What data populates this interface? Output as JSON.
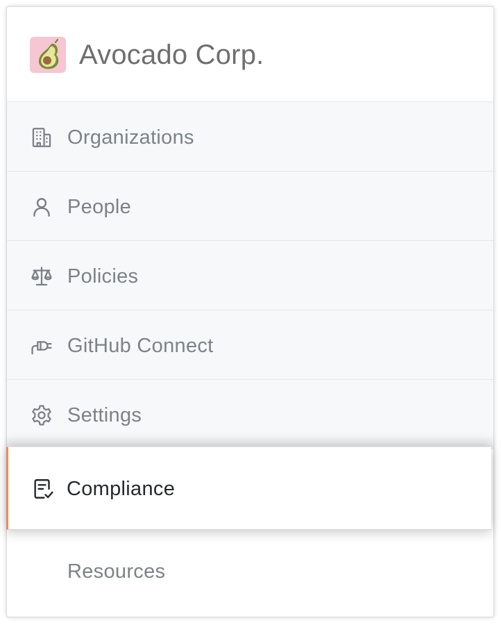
{
  "header": {
    "brand_name": "Avocado Corp.",
    "logo_icon": "avocado-icon",
    "logo_bg": "#f6c6d2"
  },
  "nav": {
    "items": [
      {
        "label": "Organizations",
        "icon": "building-icon"
      },
      {
        "label": "People",
        "icon": "person-icon"
      },
      {
        "label": "Policies",
        "icon": "law-icon"
      },
      {
        "label": "GitHub Connect",
        "icon": "plug-icon"
      },
      {
        "label": "Settings",
        "icon": "gear-icon"
      }
    ],
    "active_item": {
      "label": "Compliance",
      "icon": "checklist-icon",
      "accent": "#f08a5d"
    },
    "footer_item": {
      "label": "Resources"
    }
  }
}
